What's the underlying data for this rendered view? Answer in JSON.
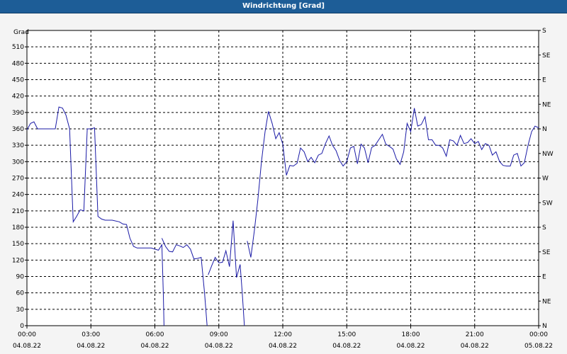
{
  "window": {
    "title": "Windrichtung [Grad]"
  },
  "chart_data": {
    "type": "line",
    "title": "Windrichtung [Grad]",
    "ylabel": "Grad",
    "ylim": [
      0,
      540
    ],
    "yticks": [
      0,
      30,
      60,
      90,
      120,
      150,
      180,
      210,
      240,
      270,
      300,
      330,
      360,
      390,
      420,
      450,
      480,
      510
    ],
    "y2ticks": [
      "N",
      "NE",
      "E",
      "SE",
      "S",
      "SW",
      "W",
      "NW",
      "N",
      "NE",
      "E",
      "SE",
      "S"
    ],
    "xlim_hours": [
      0,
      24
    ],
    "xticks": [
      {
        "time": "00:00",
        "date": "04.08.22"
      },
      {
        "time": "03:00",
        "date": "04.08.22"
      },
      {
        "time": "06:00",
        "date": "04.08.22"
      },
      {
        "time": "09:00",
        "date": "04.08.22"
      },
      {
        "time": "12:00",
        "date": "04.08.22"
      },
      {
        "time": "15:00",
        "date": "04.08.22"
      },
      {
        "time": "18:00",
        "date": "04.08.22"
      },
      {
        "time": "21:00",
        "date": "04.08.22"
      },
      {
        "time": "00:00",
        "date": "05.08.22"
      }
    ],
    "grid": true,
    "line_color": "#1a1aa6",
    "series": [
      {
        "segments": [
          [
            [
              0.0,
              358
            ],
            [
              0.17,
              370
            ],
            [
              0.33,
              373
            ],
            [
              0.5,
              360
            ],
            [
              0.67,
              360
            ],
            [
              1.0,
              360
            ],
            [
              1.33,
              360
            ],
            [
              1.5,
              400
            ],
            [
              1.67,
              398
            ],
            [
              1.83,
              385
            ],
            [
              2.0,
              360
            ],
            [
              2.17,
              190
            ],
            [
              2.33,
              200
            ],
            [
              2.5,
              212
            ],
            [
              2.67,
              210
            ],
            [
              2.83,
              360
            ],
            [
              3.0,
              360
            ],
            [
              3.17,
              362
            ],
            [
              3.33,
              200
            ],
            [
              3.5,
              195
            ],
            [
              3.67,
              193
            ],
            [
              4.0,
              193
            ],
            [
              4.33,
              190
            ],
            [
              4.5,
              186
            ],
            [
              4.67,
              185
            ],
            [
              4.83,
              160
            ],
            [
              5.0,
              145
            ],
            [
              5.17,
              142
            ],
            [
              5.33,
              142
            ],
            [
              5.5,
              142
            ],
            [
              5.83,
              142
            ],
            [
              6.0,
              140
            ],
            [
              6.17,
              138
            ],
            [
              6.33,
              148
            ],
            [
              6.4,
              55
            ],
            [
              6.43,
              0
            ]
          ],
          [
            [
              6.33,
              160
            ],
            [
              6.5,
              145
            ],
            [
              6.67,
              136
            ],
            [
              6.83,
              135
            ],
            [
              7.0,
              148
            ],
            [
              7.17,
              146
            ],
            [
              7.33,
              143
            ],
            [
              7.5,
              148
            ],
            [
              7.67,
              140
            ],
            [
              7.83,
              122
            ],
            [
              8.0,
              123
            ],
            [
              8.17,
              125
            ],
            [
              8.33,
              60
            ],
            [
              8.45,
              0
            ]
          ],
          [
            [
              8.5,
              93
            ],
            [
              8.67,
              110
            ],
            [
              8.83,
              125
            ],
            [
              9.0,
              115
            ],
            [
              9.17,
              116
            ],
            [
              9.33,
              137
            ],
            [
              9.5,
              108
            ],
            [
              9.67,
              192
            ],
            [
              9.83,
              88
            ],
            [
              10.0,
              112
            ],
            [
              10.1,
              60
            ],
            [
              10.2,
              0
            ]
          ],
          [
            [
              10.33,
              155
            ],
            [
              10.5,
              125
            ],
            [
              10.67,
              175
            ],
            [
              10.83,
              230
            ],
            [
              11.0,
              300
            ],
            [
              11.17,
              355
            ],
            [
              11.33,
              392
            ],
            [
              11.5,
              370
            ],
            [
              11.67,
              342
            ],
            [
              11.83,
              353
            ],
            [
              12.0,
              332
            ],
            [
              12.17,
              275
            ],
            [
              12.33,
              293
            ],
            [
              12.5,
              292
            ],
            [
              12.67,
              297
            ],
            [
              12.83,
              325
            ],
            [
              13.0,
              318
            ],
            [
              13.17,
              300
            ],
            [
              13.33,
              308
            ],
            [
              13.5,
              298
            ],
            [
              13.67,
              312
            ],
            [
              13.83,
              315
            ],
            [
              14.0,
              333
            ],
            [
              14.17,
              347
            ],
            [
              14.33,
              330
            ],
            [
              14.5,
              320
            ],
            [
              14.67,
              302
            ],
            [
              14.83,
              292
            ],
            [
              15.0,
              300
            ],
            [
              15.17,
              325
            ],
            [
              15.33,
              328
            ],
            [
              15.5,
              296
            ],
            [
              15.67,
              332
            ],
            [
              15.83,
              325
            ],
            [
              16.0,
              298
            ],
            [
              16.17,
              326
            ],
            [
              16.33,
              330
            ],
            [
              16.5,
              340
            ],
            [
              16.67,
              350
            ],
            [
              16.83,
              332
            ],
            [
              17.0,
              328
            ],
            [
              17.17,
              323
            ],
            [
              17.33,
              305
            ],
            [
              17.5,
              295
            ],
            [
              17.67,
              318
            ],
            [
              17.83,
              370
            ],
            [
              18.0,
              355
            ],
            [
              18.17,
              398
            ],
            [
              18.33,
              365
            ],
            [
              18.5,
              368
            ],
            [
              18.67,
              382
            ],
            [
              18.83,
              340
            ],
            [
              19.0,
              340
            ],
            [
              19.17,
              330
            ],
            [
              19.33,
              330
            ],
            [
              19.5,
              325
            ],
            [
              19.67,
              310
            ],
            [
              19.83,
              340
            ],
            [
              20.0,
              338
            ],
            [
              20.17,
              330
            ],
            [
              20.33,
              348
            ],
            [
              20.5,
              333
            ],
            [
              20.67,
              335
            ],
            [
              20.83,
              342
            ],
            [
              21.0,
              333
            ],
            [
              21.17,
              337
            ],
            [
              21.33,
              322
            ],
            [
              21.5,
              333
            ],
            [
              21.67,
              330
            ],
            [
              21.83,
              312
            ],
            [
              22.0,
              318
            ],
            [
              22.17,
              300
            ],
            [
              22.33,
              293
            ],
            [
              22.5,
              292
            ],
            [
              22.67,
              292
            ],
            [
              22.83,
              312
            ],
            [
              23.0,
              315
            ],
            [
              23.17,
              292
            ],
            [
              23.33,
              298
            ],
            [
              23.5,
              330
            ],
            [
              23.67,
              355
            ],
            [
              23.83,
              365
            ],
            [
              24.0,
              362
            ]
          ]
        ]
      }
    ]
  }
}
